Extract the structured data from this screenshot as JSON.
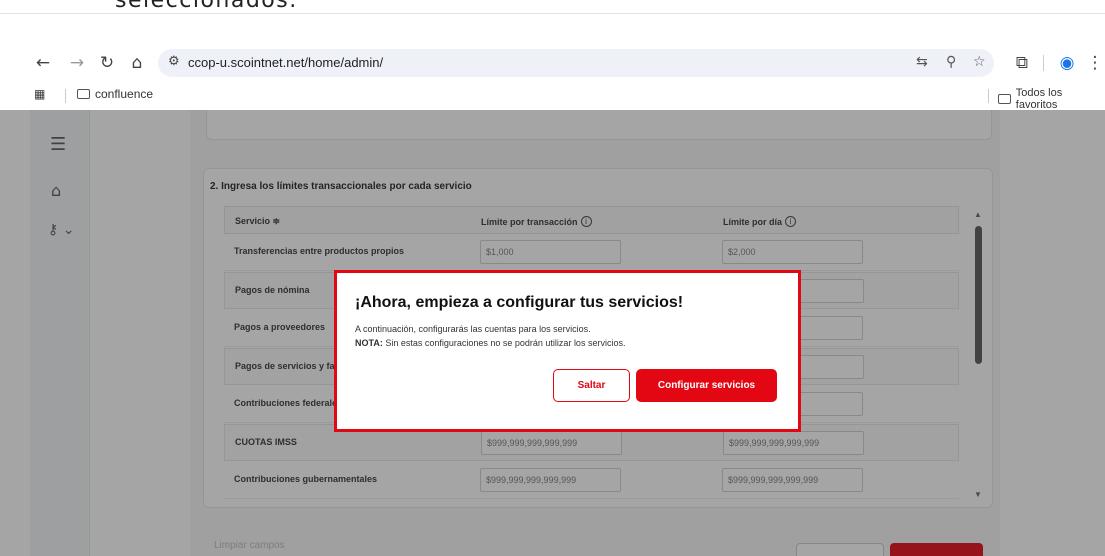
{
  "overlay_caption": "seleccionados.",
  "browser": {
    "url": "ccop-u.scointnet.net/home/admin/",
    "bookmarks": [
      {
        "label": "confluence"
      }
    ],
    "all_bookmarks": "Todos los favoritos"
  },
  "table": {
    "section_title": "2. Ingresa los límites transaccionales por cada servicio",
    "columns": [
      "Servicio ≑",
      "Límite por transacción",
      "Límite por día"
    ],
    "rows": [
      {
        "name": "Transferencias entre productos propios",
        "per_tx": "$1,000",
        "per_day": "$2,000"
      },
      {
        "name": "Pagos de nómina",
        "per_tx": "",
        "per_day": "999"
      },
      {
        "name": "Pagos a proveedores",
        "per_tx": "",
        "per_day": "999"
      },
      {
        "name": "Pagos de servicios y fact",
        "per_tx": "",
        "per_day": "999"
      },
      {
        "name": "Contribuciones federale",
        "per_tx": "",
        "per_day": "999"
      },
      {
        "name": "CUOTAS IMSS",
        "per_tx": "$999,999,999,999,999",
        "per_day": "$999,999,999,999,999"
      },
      {
        "name": "Contribuciones gubernamentales",
        "per_tx": "$999,999,999,999,999",
        "per_day": "$999,999,999,999,999"
      }
    ]
  },
  "footer": {
    "clear_label": "Limpiar campos"
  },
  "modal": {
    "title": "¡Ahora, empieza a configurar tus servicios!",
    "line1": "A continuación, configurarás las cuentas para los servicios.",
    "note_label": "NOTA:",
    "note_text": " Sin estas configuraciones no se podrán utilizar los servicios.",
    "skip_label": "Saltar",
    "configure_label": "Configurar servicios"
  },
  "colors": {
    "accent": "#e30613"
  }
}
